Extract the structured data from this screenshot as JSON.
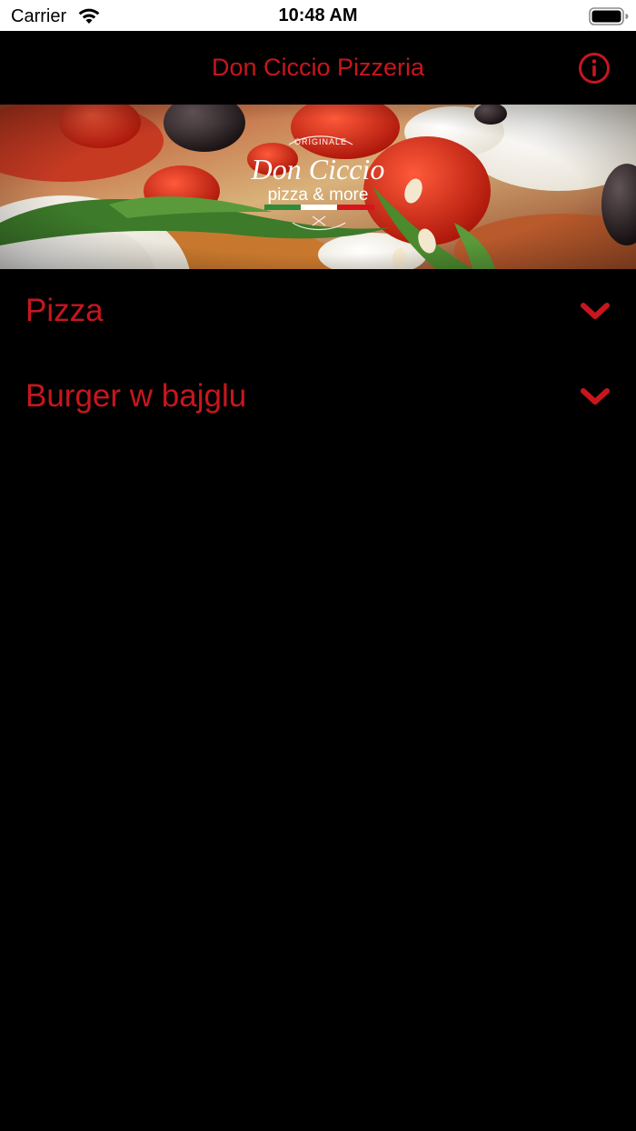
{
  "status_bar": {
    "carrier": "Carrier",
    "time": "10:48 AM"
  },
  "nav": {
    "title": "Don Ciccio Pizzeria",
    "info_icon": "info-circle-icon"
  },
  "hero": {
    "logo_top": "ORIGINALE",
    "logo_script": "Don Ciccio",
    "logo_tagline": "pizza & more"
  },
  "menu": {
    "items": [
      {
        "label": "Pizza",
        "icon": "chevron-down-icon"
      },
      {
        "label": "Burger w bajglu",
        "icon": "chevron-down-icon"
      }
    ]
  },
  "colors": {
    "accent": "#c8161d",
    "background": "#000000"
  }
}
